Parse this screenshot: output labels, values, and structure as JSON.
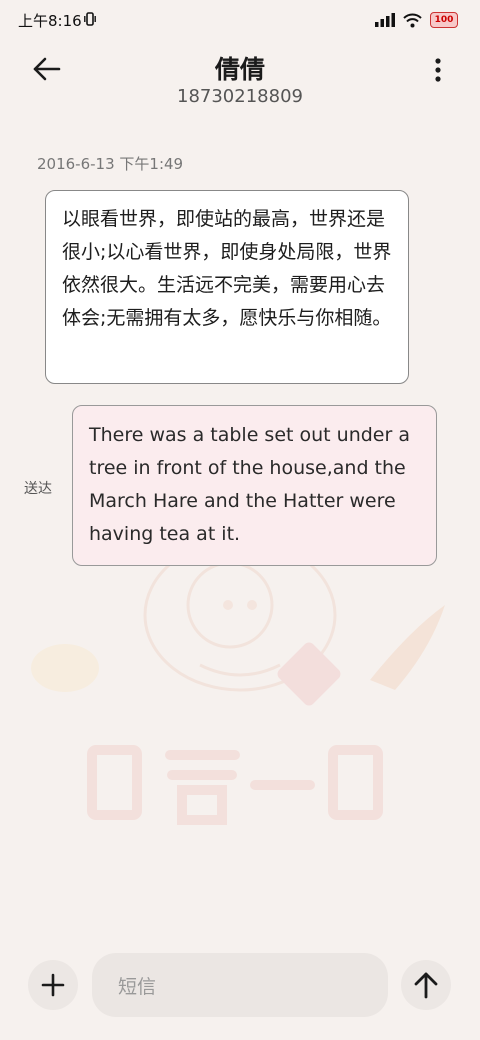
{
  "status_bar": {
    "time": "上午8:16",
    "battery": "100"
  },
  "header": {
    "contact_name": "倩倩",
    "phone_number": "18730218809"
  },
  "conversation": {
    "timestamp": "2016-6-13 下午1:49",
    "received_message": "以眼看世界，即使站的最高，世界还是很小;以心看世界，即使身处局限，世界依然很大。生活远不完美，需要用心去体会;无需拥有太多，愿快乐与你相随。",
    "sent_message": "There was a table set out under a tree in front of the house,and the March Hare and the Hatter were having tea at it.",
    "sent_status": "送达"
  },
  "composer": {
    "placeholder": "短信"
  },
  "colors": {
    "background": "#f6f1ee",
    "sent_bubble": "#fbecee",
    "received_bubble": "#ffffff"
  },
  "icons": {
    "back": "arrow-left-icon",
    "more": "more-vertical-icon",
    "add": "plus-icon",
    "send": "arrow-up-icon"
  }
}
